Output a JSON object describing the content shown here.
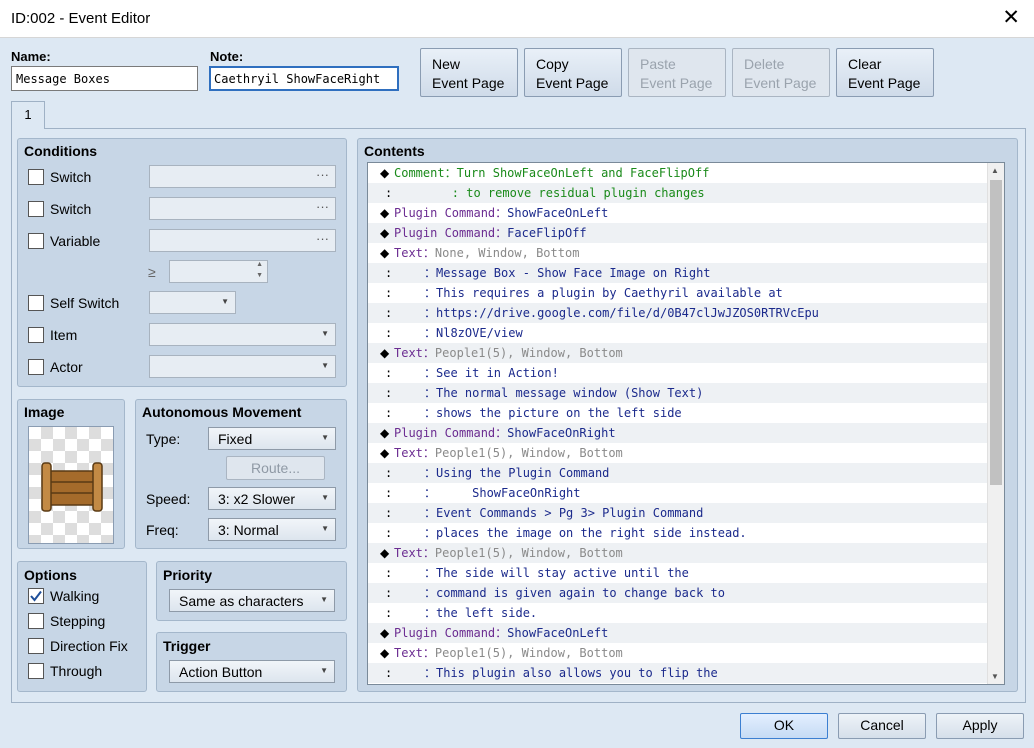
{
  "window": {
    "title": "ID:002 - Event Editor",
    "close": "✕"
  },
  "name": {
    "label": "Name:",
    "value": "Message Boxes"
  },
  "note": {
    "label": "Note:",
    "value": "Caethryil ShowFaceRight"
  },
  "page_buttons": {
    "new": [
      "New",
      "Event Page"
    ],
    "copy": [
      "Copy",
      "Event Page"
    ],
    "paste": [
      "Paste",
      "Event Page"
    ],
    "delete": [
      "Delete",
      "Event Page"
    ],
    "clear": [
      "Clear",
      "Event Page"
    ]
  },
  "tab": {
    "label": "1"
  },
  "conditions": {
    "heading": "Conditions",
    "switch1": "Switch",
    "switch2": "Switch",
    "variable": "Variable",
    "ge": "≥",
    "self_switch": "Self Switch",
    "item": "Item",
    "actor": "Actor",
    "ellipsis": "···"
  },
  "image": {
    "heading": "Image"
  },
  "movement": {
    "heading": "Autonomous Movement",
    "type_label": "Type:",
    "type_value": "Fixed",
    "route": "Route...",
    "speed_label": "Speed:",
    "speed_value": "3: x2 Slower",
    "freq_label": "Freq:",
    "freq_value": "3: Normal"
  },
  "options": {
    "heading": "Options",
    "walking": "Walking",
    "walking_checked": true,
    "stepping": "Stepping",
    "direction_fix": "Direction Fix",
    "through": "Through"
  },
  "priority": {
    "heading": "Priority",
    "value": "Same as characters"
  },
  "trigger": {
    "heading": "Trigger",
    "value": "Action Button"
  },
  "contents": {
    "heading": "Contents",
    "rows": [
      {
        "type": "comment",
        "head": "Comment",
        "text": "Turn ShowFaceOnLeft and FaceFlipOff"
      },
      {
        "type": "comment-cont",
        "text": "      : to remove residual plugin changes"
      },
      {
        "type": "plugin",
        "head": "Plugin Command",
        "text": "ShowFaceOnLeft"
      },
      {
        "type": "plugin",
        "head": "Plugin Command",
        "text": "FaceFlipOff"
      },
      {
        "type": "textcmd",
        "head": "Text",
        "text": "None, Window, Bottom"
      },
      {
        "type": "textline",
        "text": "Message Box - Show Face Image on Right"
      },
      {
        "type": "textline",
        "text": "This requires a plugin by Caethyril available at"
      },
      {
        "type": "textline",
        "text": "https://drive.google.com/file/d/0B47clJwJZOS0RTRVcEpu"
      },
      {
        "type": "textline",
        "text": "Nl8zOVE/view"
      },
      {
        "type": "textcmd",
        "head": "Text",
        "text": "People1(5), Window, Bottom"
      },
      {
        "type": "textline",
        "text": "See it in Action!"
      },
      {
        "type": "textline",
        "text": "The normal message window (Show Text)"
      },
      {
        "type": "textline",
        "text": "shows the picture on the left side"
      },
      {
        "type": "plugin",
        "head": "Plugin Command",
        "text": "ShowFaceOnRight"
      },
      {
        "type": "textcmd",
        "head": "Text",
        "text": "People1(5), Window, Bottom"
      },
      {
        "type": "textline",
        "text": "Using the Plugin Command"
      },
      {
        "type": "textline",
        "text": "     ShowFaceOnRight"
      },
      {
        "type": "textline",
        "text": "Event Commands > Pg 3> Plugin Command"
      },
      {
        "type": "textline",
        "text": "places the image on the right side instead."
      },
      {
        "type": "textcmd",
        "head": "Text",
        "text": "People1(5), Window, Bottom"
      },
      {
        "type": "textline",
        "text": "The side will stay active until the"
      },
      {
        "type": "textline",
        "text": "command is given again to change back to"
      },
      {
        "type": "textline",
        "text": "the left side."
      },
      {
        "type": "plugin",
        "head": "Plugin Command",
        "text": "ShowFaceOnLeft"
      },
      {
        "type": "textcmd",
        "head": "Text",
        "text": "People1(5), Window, Bottom"
      },
      {
        "type": "textline",
        "text": "This plugin also allows you to flip the"
      }
    ]
  },
  "footer": {
    "ok": "OK",
    "cancel": "Cancel",
    "apply": "Apply"
  },
  "colors": {
    "comment": "#1a8a1a",
    "plugin": "#6b2c91",
    "text_head": "#6b2c91",
    "text_params": "#8a8a8a",
    "text_body": "#1b2a8c",
    "accent": "#2f6fbf"
  }
}
